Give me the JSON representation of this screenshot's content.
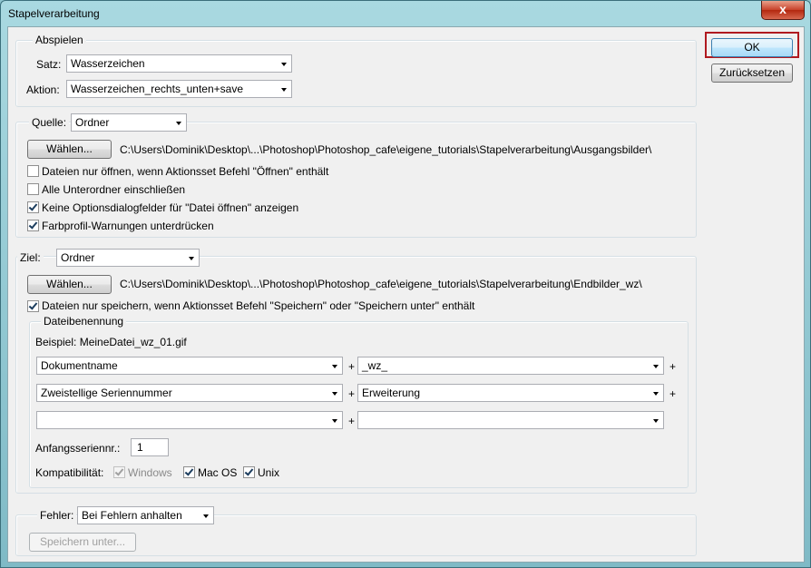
{
  "window": {
    "title": "Stapelverarbeitung",
    "close_glyph": "x"
  },
  "buttons": {
    "ok": "OK",
    "reset": "Zurücksetzen"
  },
  "abspielen": {
    "legend": "Abspielen",
    "satz_label": "Satz:",
    "satz_value": "Wasserzeichen",
    "aktion_label": "Aktion:",
    "aktion_value": "Wasserzeichen_rechts_unten+save"
  },
  "quelle": {
    "label": "Quelle:",
    "value": "Ordner",
    "choose_button": "Wählen...",
    "path": "C:\\Users\\Dominik\\Desktop\\...\\Photoshop\\Photoshop_cafe\\eigene_tutorials\\Stapelverarbeitung\\Ausgangsbilder\\",
    "options": [
      {
        "label": "Dateien nur öffnen, wenn Aktionsset Befehl \"Öffnen\" enthält",
        "checked": false
      },
      {
        "label": "Alle Unterordner einschließen",
        "checked": false
      },
      {
        "label": "Keine Optionsdialogfelder für \"Datei öffnen\" anzeigen",
        "checked": true
      },
      {
        "label": "Farbprofil-Warnungen unterdrücken",
        "checked": true
      }
    ]
  },
  "ziel": {
    "label": "Ziel:",
    "value": "Ordner",
    "choose_button": "Wählen...",
    "path": "C:\\Users\\Dominik\\Desktop\\...\\Photoshop\\Photoshop_cafe\\eigene_tutorials\\Stapelverarbeitung\\Endbilder_wz\\",
    "save_option": {
      "label": "Dateien nur speichern, wenn Aktionsset Befehl \"Speichern\" oder \"Speichern unter\" enthält",
      "checked": true
    }
  },
  "dateibenennung": {
    "legend": "Dateibenennung",
    "example": "Beispiel: MeineDatei_wz_01.gif",
    "rows": [
      {
        "left": "Dokumentname",
        "right": "_wz_"
      },
      {
        "left": "Zweistellige Seriennummer",
        "right": "Erweiterung"
      },
      {
        "left": "",
        "right": ""
      }
    ],
    "plus": "+",
    "start_serial_label": "Anfangsseriennr.:",
    "start_serial_value": "1",
    "compat_label": "Kompatibilität:",
    "compat": [
      {
        "label": "Windows",
        "checked": true,
        "disabled": true
      },
      {
        "label": "Mac OS",
        "checked": true,
        "disabled": false
      },
      {
        "label": "Unix",
        "checked": true,
        "disabled": false
      }
    ]
  },
  "fehler": {
    "label": "Fehler:",
    "value": "Bei Fehlern anhalten",
    "save_button": "Speichern unter..."
  }
}
